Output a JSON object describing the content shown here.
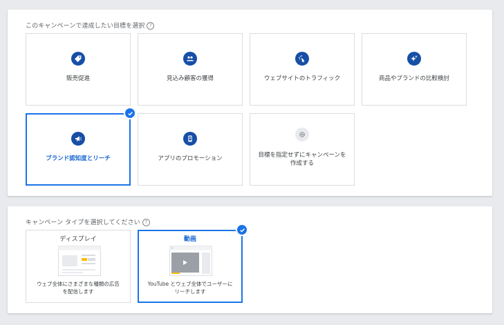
{
  "goals_section": {
    "label": "このキャンペーンで達成したい目標を選択",
    "help": "?",
    "cards": [
      {
        "label": "販売促進",
        "icon": "tag-icon",
        "selected": false
      },
      {
        "label": "見込み顧客の獲得",
        "icon": "people-icon",
        "selected": false
      },
      {
        "label": "ウェブサイトのトラフィック",
        "icon": "cursor-click-icon",
        "selected": false
      },
      {
        "label": "商品やブランドの比較検討",
        "icon": "sparkle-icon",
        "selected": false
      },
      {
        "label": "ブランド認知度とリーチ",
        "icon": "megaphone-icon",
        "selected": true
      },
      {
        "label": "アプリのプロモーション",
        "icon": "phone-icon",
        "selected": false
      },
      {
        "label": "目標を指定せずにキャンペーンを作成する",
        "line1": "目標を指定せずにキャンペーンを",
        "line2": "作成する",
        "icon": "gear-icon",
        "selected": false
      }
    ]
  },
  "types_section": {
    "label": "キャンペーン タイプを選択してください",
    "help": "?",
    "cards": [
      {
        "title": "ディスプレイ",
        "desc_line1": "ウェブ全体にさまざまな種類の広告",
        "desc_line2": "を配信します",
        "icon": "display-ad-illustration",
        "selected": false
      },
      {
        "title": "動画",
        "desc_line1": "YouTube とウェブ全体でユーザーに",
        "desc_line2": "リーチします",
        "icon": "video-ad-illustration",
        "selected": true
      }
    ]
  },
  "colors": {
    "accent": "#1a73e8",
    "icon_dark": "#174ea6",
    "selected_text": "#1967d2",
    "border": "#dadce0",
    "highlight_yellow": "#fbbc04"
  }
}
